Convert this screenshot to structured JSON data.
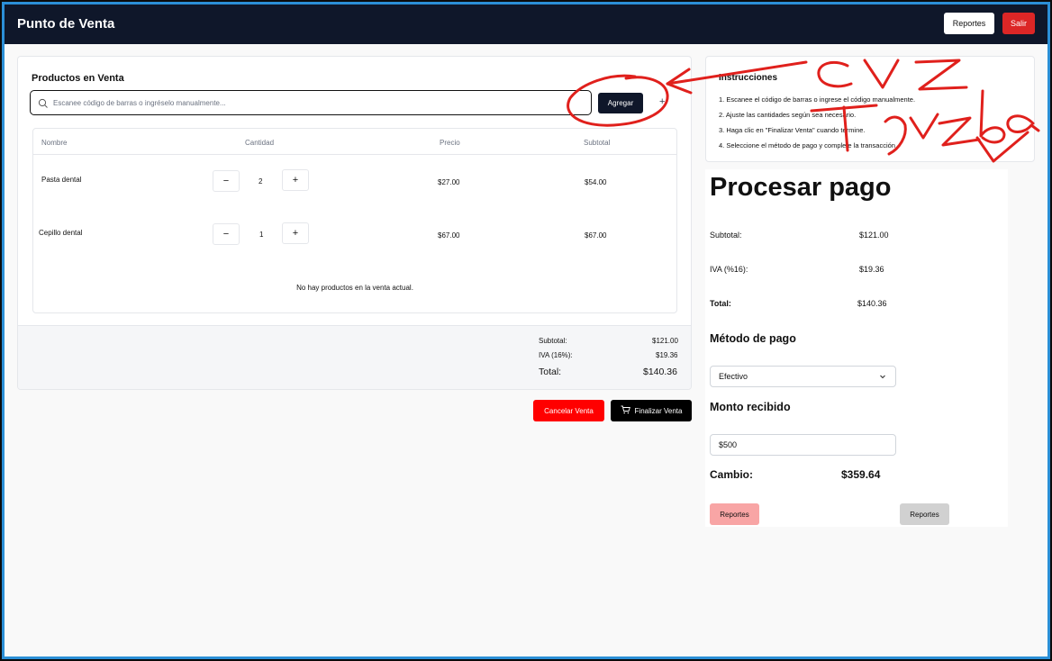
{
  "header": {
    "title": "Punto de Venta",
    "reportes_label": "Reportes",
    "salir_label": "Salir"
  },
  "sale": {
    "title": "Productos en Venta",
    "search_placeholder": "Escanee código de barras o ingréselo manualmente...",
    "add_label": "Agregar",
    "plus_label": "+",
    "columns": [
      "Nombre",
      "Cantidad",
      "Precio",
      "Subtotal"
    ],
    "rows": [
      {
        "name": "Pasta dental",
        "qty": "2",
        "price": "$27.00",
        "subtotal": "$54.00"
      },
      {
        "name": "Cepillo dental",
        "qty": "1",
        "price": "$67.00",
        "subtotal": "$67.00"
      }
    ],
    "minus_symbol": "−",
    "plus_symbol": "+",
    "empty_message": "No hay productos en la venta actual.",
    "totals": {
      "subtotal_label": "Subtotal:",
      "subtotal_value": "$121.00",
      "iva_label": "IVA (16%):",
      "iva_value": "$19.36",
      "total_label": "Total:",
      "total_value": "$140.36"
    },
    "cancel_label": "Cancelar Venta",
    "finish_label": "Finalizar Venta"
  },
  "instructions": {
    "title": "Instrucciones",
    "steps": [
      "1. Escanee el código de barras o ingrese el código manualmente.",
      "2. Ajuste las cantidades según sea necesario.",
      "3. Haga clic en \"Finalizar Venta\" cuando termine.",
      "4. Seleccione el método de pago y complete la transacción."
    ]
  },
  "payment": {
    "title": "Procesar pago",
    "subtotal_label": "Subtotal:",
    "subtotal_value": "$121.00",
    "iva_label": "IVA (%16):",
    "iva_value": "$19.36",
    "total_label": "Total:",
    "total_value": "$140.36",
    "method_heading": "Método de pago",
    "method_value": "Efectivo",
    "amount_heading": "Monto recibido",
    "amount_value": "$500",
    "change_label": "Cambio:",
    "change_value": "$359.64",
    "reportes_pink": "Reportes",
    "reportes_gray": "Reportes"
  },
  "annotation": {
    "text_top": "CVZ",
    "text_bottom": "Prueba",
    "color": "#e0201c"
  },
  "colors": {
    "topbar": "#0f172a",
    "danger": "#dc2626",
    "cancel": "#ff0000",
    "frame": "#2b8fd6"
  }
}
